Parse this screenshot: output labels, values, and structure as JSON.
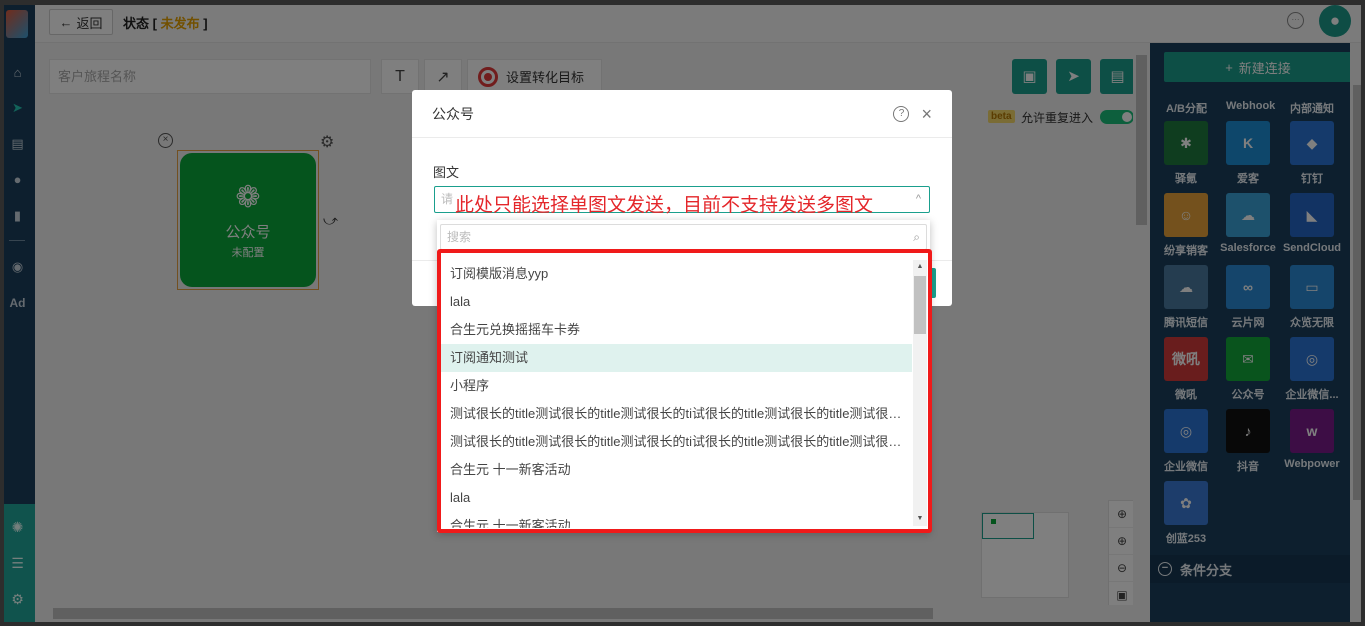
{
  "topbar": {
    "back_label": "返回",
    "status_label": "状态 [",
    "status_value": "未发布",
    "status_end": "]"
  },
  "toolbar": {
    "name_placeholder": "客户旅程名称",
    "text_tool": "T",
    "arrow_tool": "↗",
    "goal_label": "设置转化目标"
  },
  "options": {
    "beta": "beta",
    "repeat_label": "允许重复进入"
  },
  "node": {
    "title": "公众号",
    "subtitle": "未配置"
  },
  "right_panel": {
    "new_connection": "新建连接",
    "top_labels": [
      "A/B分配",
      "Webhook",
      "内部通知"
    ],
    "tiles": [
      {
        "label": "驿氪",
        "color": "#1f7a3e",
        "glyph": "✱"
      },
      {
        "label": "爱客",
        "color": "#1d8ed6",
        "glyph": "K"
      },
      {
        "label": "钉钉",
        "color": "#2a74d6",
        "glyph": "◆"
      },
      {
        "label": "纷享销客",
        "color": "#e8a33a",
        "glyph": "☺"
      },
      {
        "label": "Salesforce",
        "color": "#3aa2d8",
        "glyph": "☁"
      },
      {
        "label": "SendCloud",
        "color": "#2566c7",
        "glyph": "◣"
      },
      {
        "label": "腾讯短信",
        "color": "#4a7aa0",
        "glyph": "☁"
      },
      {
        "label": "云片网",
        "color": "#2a8ad6",
        "glyph": "∞"
      },
      {
        "label": "众览无限",
        "color": "#2a8ad6",
        "glyph": "▭"
      },
      {
        "label": "微吼",
        "color": "#d23a3a",
        "glyph": "微吼"
      },
      {
        "label": "公众号",
        "color": "#12a83b",
        "glyph": "✉"
      },
      {
        "label": "企业微信...",
        "color": "#2a74d6",
        "glyph": "◎"
      },
      {
        "label": "企业微信",
        "color": "#2a74d6",
        "glyph": "◎"
      },
      {
        "label": "抖音",
        "color": "#111111",
        "glyph": "♪"
      },
      {
        "label": "Webpower",
        "color": "#7a1a8a",
        "glyph": "w"
      },
      {
        "label": "创蓝253",
        "color": "#3a7ad6",
        "glyph": "✿"
      }
    ],
    "section_label": "条件分支"
  },
  "modal": {
    "title": "公众号",
    "field_label": "图文",
    "select_placeholder": "请",
    "annotation": "此处只能选择单图文发送，目前不支持发送多图文"
  },
  "dropdown": {
    "search_placeholder": "搜索",
    "items": [
      "订阅模版消息yyp",
      "lala",
      "合生元兑换摇摇车卡券",
      "订阅通知测试",
      "小程序",
      "测试很长的title测试很长的title测试很长的ti试很长的title测试很长的title测试很长的title测试很长的title",
      "测试很长的title测试很长的title测试很长的ti试很长的title测试很长的title测试很长的title测试很长的title",
      "合生元 十一新客活动",
      "lala",
      "合生元 十一新客活动"
    ],
    "highlighted_index": 3
  },
  "colors": {
    "brand": "#1a9f8d",
    "node_green": "#0aa83a",
    "annotation_red": "#e4262a"
  }
}
